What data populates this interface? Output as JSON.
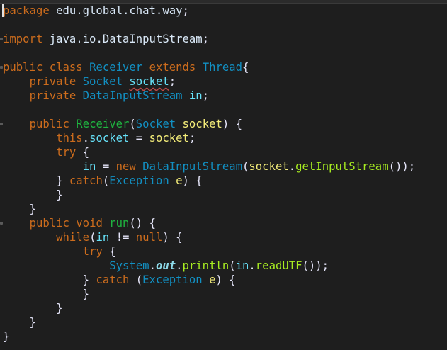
{
  "editor": {
    "lines": [
      {
        "tokens": [
          [
            "kw",
            "package"
          ],
          [
            "pkg",
            " edu.global.chat.way"
          ],
          [
            "op",
            ";"
          ]
        ]
      },
      {
        "tokens": [
          [
            "kw",
            "import"
          ],
          [
            "pkg",
            " java.io.DataInputStream"
          ],
          [
            "op",
            ";"
          ]
        ]
      },
      {
        "tokens": [
          [
            "kw",
            "public"
          ],
          [
            "op",
            " "
          ],
          [
            "kw",
            "class"
          ],
          [
            "op",
            " "
          ],
          [
            "cls",
            "Receiver"
          ],
          [
            "op",
            " "
          ],
          [
            "kw",
            "extends"
          ],
          [
            "op",
            " "
          ],
          [
            "cls",
            "Thread"
          ],
          [
            "op",
            "{"
          ]
        ]
      },
      {
        "tokens": [
          [
            "op",
            "    "
          ],
          [
            "kw",
            "private"
          ],
          [
            "op",
            " "
          ],
          [
            "cls",
            "Socket"
          ],
          [
            "op",
            " "
          ],
          [
            "fld squiggle",
            "socket"
          ],
          [
            "op",
            ";"
          ]
        ]
      },
      {
        "tokens": [
          [
            "op",
            "    "
          ],
          [
            "kw",
            "private"
          ],
          [
            "op",
            " "
          ],
          [
            "cls",
            "DataInputStream"
          ],
          [
            "op",
            " "
          ],
          [
            "fld",
            "in"
          ],
          [
            "op",
            ";"
          ]
        ]
      },
      {
        "tokens": [
          [
            "op",
            "    "
          ],
          [
            "kw",
            "public"
          ],
          [
            "op",
            " "
          ],
          [
            "mth",
            "Receiver"
          ],
          [
            "op",
            "("
          ],
          [
            "cls",
            "Socket"
          ],
          [
            "op",
            " "
          ],
          [
            "var",
            "socket"
          ],
          [
            "op",
            ") {"
          ]
        ]
      },
      {
        "tokens": [
          [
            "op",
            "        "
          ],
          [
            "kw",
            "this"
          ],
          [
            "op",
            "."
          ],
          [
            "fld",
            "socket"
          ],
          [
            "op",
            " = "
          ],
          [
            "var",
            "socket"
          ],
          [
            "op",
            ";"
          ]
        ]
      },
      {
        "tokens": [
          [
            "op",
            "        "
          ],
          [
            "kw",
            "try"
          ],
          [
            "op",
            " {"
          ]
        ]
      },
      {
        "tokens": [
          [
            "op",
            "            "
          ],
          [
            "fld",
            "in"
          ],
          [
            "op",
            " = "
          ],
          [
            "kw",
            "new"
          ],
          [
            "op",
            " "
          ],
          [
            "cls",
            "DataInputStream"
          ],
          [
            "op",
            "("
          ],
          [
            "var",
            "socket"
          ],
          [
            "op",
            "."
          ],
          [
            "mthc",
            "getInputStream"
          ],
          [
            "op",
            "());"
          ]
        ]
      },
      {
        "tokens": [
          [
            "op",
            "        } "
          ],
          [
            "kw",
            "catch"
          ],
          [
            "op",
            "("
          ],
          [
            "cls",
            "Exception"
          ],
          [
            "op",
            " "
          ],
          [
            "var",
            "e"
          ],
          [
            "op",
            ") {"
          ]
        ]
      },
      {
        "tokens": [
          [
            "op",
            "        }"
          ]
        ]
      },
      {
        "tokens": [
          [
            "op",
            "    }"
          ]
        ]
      },
      {
        "tokens": [
          [
            "op",
            "    "
          ],
          [
            "kw",
            "public"
          ],
          [
            "op",
            " "
          ],
          [
            "kw",
            "void"
          ],
          [
            "op",
            " "
          ],
          [
            "mth",
            "run"
          ],
          [
            "op",
            "() {"
          ]
        ]
      },
      {
        "tokens": [
          [
            "op",
            "        "
          ],
          [
            "kw",
            "while"
          ],
          [
            "op",
            "("
          ],
          [
            "fld",
            "in"
          ],
          [
            "op",
            " != "
          ],
          [
            "kw",
            "null"
          ],
          [
            "op",
            ") {"
          ]
        ]
      },
      {
        "tokens": [
          [
            "op",
            "            "
          ],
          [
            "kw",
            "try"
          ],
          [
            "op",
            " {"
          ]
        ]
      },
      {
        "tokens": [
          [
            "op",
            "                "
          ],
          [
            "cls",
            "System"
          ],
          [
            "op",
            "."
          ],
          [
            "sfld",
            "out"
          ],
          [
            "op",
            "."
          ],
          [
            "mthc",
            "println"
          ],
          [
            "op",
            "("
          ],
          [
            "fld",
            "in"
          ],
          [
            "op",
            "."
          ],
          [
            "mthc",
            "readUTF"
          ],
          [
            "op",
            "());"
          ]
        ]
      },
      {
        "tokens": [
          [
            "op",
            "            } "
          ],
          [
            "kw",
            "catch"
          ],
          [
            "op",
            " ("
          ],
          [
            "cls",
            "Exception"
          ],
          [
            "op",
            " "
          ],
          [
            "var",
            "e"
          ],
          [
            "op",
            ") {"
          ]
        ]
      },
      {
        "tokens": [
          [
            "op",
            "            }"
          ]
        ]
      },
      {
        "tokens": [
          [
            "op",
            "        }"
          ]
        ]
      },
      {
        "tokens": [
          [
            "op",
            "    }"
          ]
        ]
      },
      {
        "tokens": [
          [
            "op",
            "}"
          ]
        ]
      }
    ]
  }
}
